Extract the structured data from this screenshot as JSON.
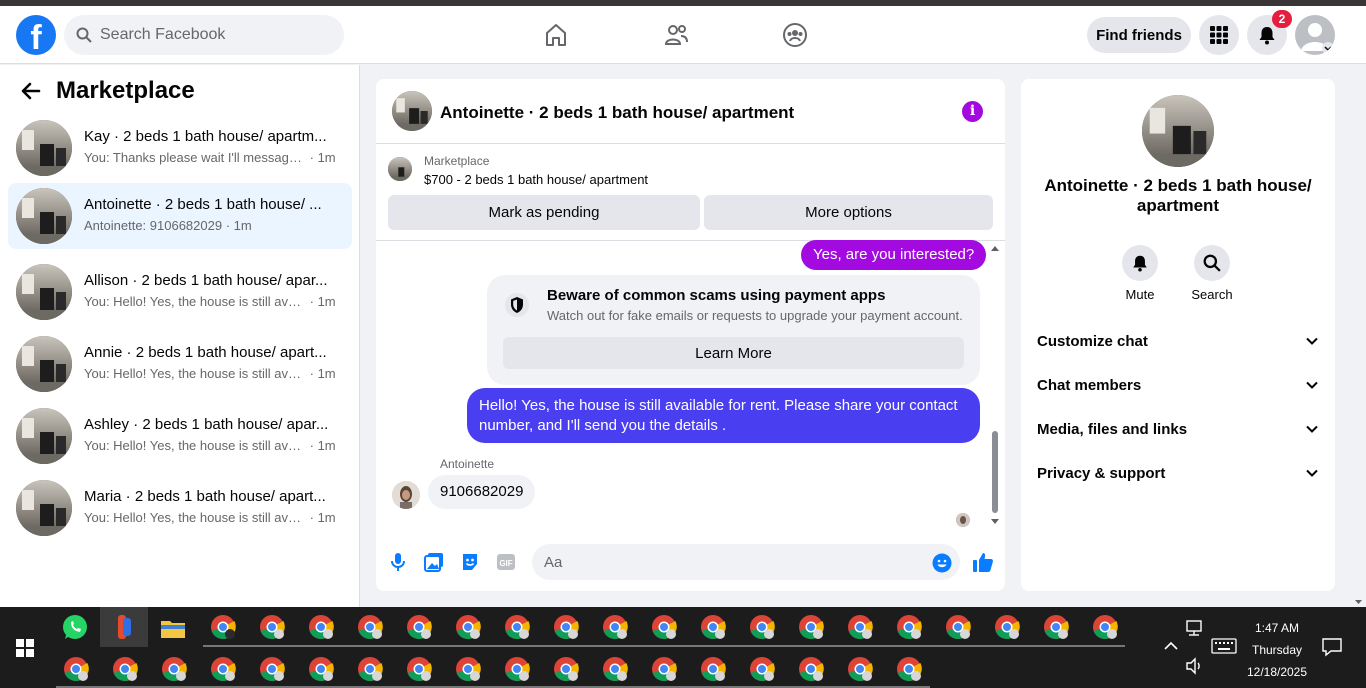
{
  "header": {
    "search_placeholder": "Search Facebook",
    "find_friends": "Find friends",
    "notification_count": "2"
  },
  "left_panel": {
    "title": "Marketplace",
    "conversations": [
      {
        "title": "Kay · 2 beds 1 bath house/ apartm...",
        "preview": "You: Thanks please wait I'll message ...",
        "time": "· 1m"
      },
      {
        "title": "Antoinette · 2 beds 1 bath house/ ...",
        "preview": "Antoinette: 9106682029",
        "time": "· 1m"
      },
      {
        "title": "Allison · 2 beds 1 bath house/ apar...",
        "preview": "You: Hello! Yes, the house is still avail...",
        "time": "· 1m"
      },
      {
        "title": "Annie · 2 beds 1 bath house/ apart...",
        "preview": "You: Hello! Yes, the house is still avail...",
        "time": "· 1m"
      },
      {
        "title": "Ashley · 2 beds 1 bath house/ apar...",
        "preview": "You: Hello! Yes, the house is still avail...",
        "time": "· 1m"
      },
      {
        "title": "Maria · 2 beds 1 bath house/ apart...",
        "preview": "You: Hello! Yes, the house is still avail...",
        "time": "· 1m"
      }
    ]
  },
  "chat": {
    "title": "Antoinette · 2 beds 1 bath house/ apartment",
    "listing_source": "Marketplace",
    "listing_title": "$700 - 2 beds 1 bath house/ apartment",
    "mark_pending": "Mark as pending",
    "more_options": "More options",
    "msg_interested": "Yes, are you interested?",
    "scam_title": "Beware of common scams using payment apps",
    "scam_text": "Watch out for fake emails or requests to upgrade your payment account.",
    "learn_more": "Learn More",
    "msg_available": "Hello! Yes, the house is still available for rent. Please share your contact number, and I'll send you the details .",
    "sender": "Antoinette",
    "msg_phone": "9106682029",
    "composer_placeholder": "Aa"
  },
  "right_panel": {
    "name": "Antoinette · 2 beds 1 bath house/ apartment",
    "mute": "Mute",
    "search": "Search",
    "sections": [
      "Customize chat",
      "Chat members",
      "Media, files and links",
      "Privacy & support"
    ]
  },
  "taskbar": {
    "time": "1:47 AM",
    "day": "Thursday",
    "date": "12/18/2025"
  },
  "colors": {
    "brand": "#1877f2",
    "accent_purple": "#a30ae0",
    "bubble_blue": "#4a3ef1"
  }
}
